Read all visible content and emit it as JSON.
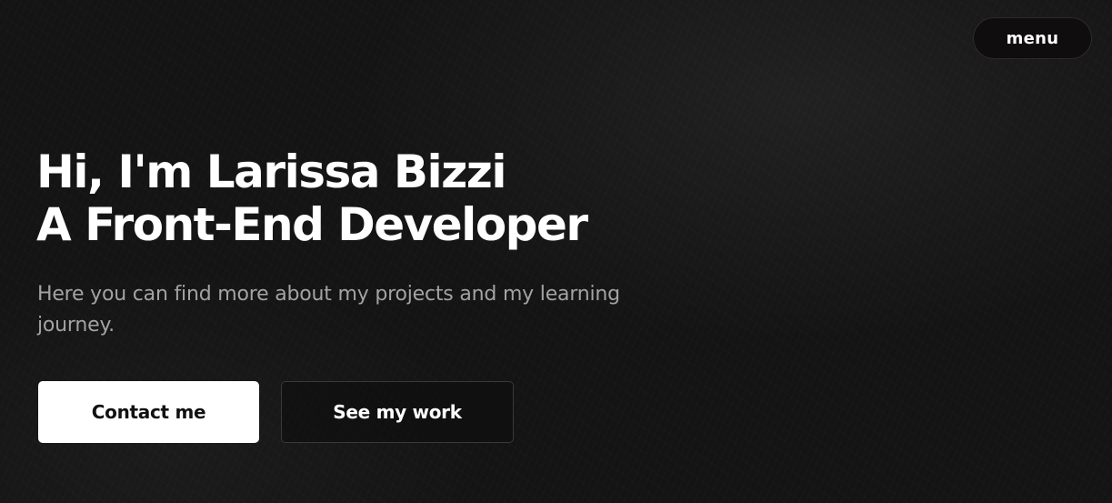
{
  "nav": {
    "menu_label": "menu"
  },
  "hero": {
    "title_line_1": "Hi, I'm Larissa Bizzi",
    "title_line_2": "A Front-End Developer",
    "subtitle": "Here you can find more about my projects and my learning journey.",
    "primary_cta_label": "Contact me",
    "secondary_cta_label": "See my work"
  },
  "colors": {
    "background": "#141414",
    "text_primary": "#ffffff",
    "text_muted": "#a3a3a3",
    "primary_button_bg": "#ffffff",
    "primary_button_text": "#111111",
    "secondary_button_border": "#3a3838",
    "menu_button_bg": "#0f0d0d"
  }
}
